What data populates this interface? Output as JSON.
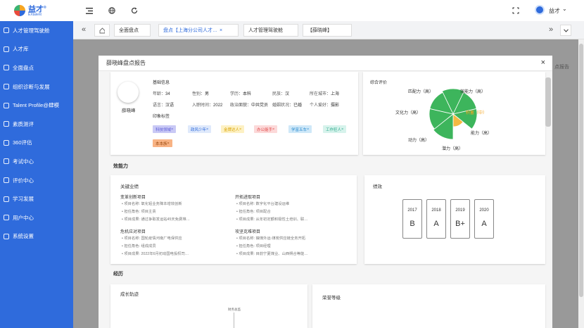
{
  "brand": {
    "name": "益才",
    "sub": "EXtalent",
    "mark": "®"
  },
  "sidebar": {
    "items": [
      {
        "label": "人才管理驾驶舱",
        "icon": "dashboard-icon"
      },
      {
        "label": "人才库",
        "icon": "user-icon"
      },
      {
        "label": "全面盘点",
        "icon": "inventory-icon"
      },
      {
        "label": "组织诊断与发展",
        "icon": "org-icon"
      },
      {
        "label": "Talent Profile@肆模",
        "icon": "profile-icon"
      },
      {
        "label": "素质测评",
        "icon": "test-icon"
      },
      {
        "label": "360评估",
        "icon": "eval-icon"
      },
      {
        "label": "考试中心",
        "icon": "exam-icon"
      },
      {
        "label": "评价中心",
        "icon": "review-icon"
      },
      {
        "label": "学习发展",
        "icon": "learn-icon"
      },
      {
        "label": "用户中心",
        "icon": "users-icon"
      },
      {
        "label": "系统设置",
        "icon": "settings-icon"
      }
    ]
  },
  "header": {
    "user": "益才",
    "caret": "⌄"
  },
  "tabs": [
    {
      "label": "全面盘点",
      "active": false
    },
    {
      "label": "盘点【上海分公司人才…",
      "active": true
    },
    {
      "label": "人才管理驾驶舱",
      "active": false
    },
    {
      "label": "【薛晓峰】",
      "active": false
    }
  ],
  "tab_close": "×",
  "bg_right_label": "点报告",
  "modal": {
    "title": "薛晓峰盘点报告",
    "close": "×",
    "profile": {
      "name": "薛晓峰",
      "basic_title": "基础信息",
      "fields": [
        {
          "k": "年龄：",
          "v": "34"
        },
        {
          "k": "性别：",
          "v": "男"
        },
        {
          "k": "学历：",
          "v": "本科"
        },
        {
          "k": "民族：",
          "v": "汉"
        },
        {
          "k": "所在城市：",
          "v": "上海"
        },
        {
          "k": "语言：",
          "v": "汉语"
        },
        {
          "k": "入职时间：",
          "v": "2022"
        },
        {
          "k": "政治面貌：",
          "v": "中共党员"
        },
        {
          "k": "婚姻状况：",
          "v": "已婚"
        },
        {
          "k": "个人爱好：",
          "v": "摄影"
        }
      ],
      "tags_title": "印象标签",
      "tags": [
        {
          "label": "科技领域",
          "bg": "#c9c9f5",
          "fg": "#5b5bd6"
        },
        {
          "label": "政风少年",
          "bg": "#dfe9fb",
          "fg": "#2f6bdc"
        },
        {
          "label": "金牌达人",
          "bg": "#fdf1c4",
          "fg": "#d9a200"
        },
        {
          "label": "办公能手",
          "bg": "#fcd9d9",
          "fg": "#e04848"
        },
        {
          "label": "学富五车",
          "bg": "#cfe8f8",
          "fg": "#2a8bd0"
        },
        {
          "label": "工作狂人",
          "bg": "#d7f3ec",
          "fg": "#2aa88a"
        },
        {
          "label": "本本族",
          "bg": "#f8b384",
          "fg": "#9a4a10"
        }
      ]
    },
    "evaluation": {
      "title": "综合评价",
      "labels": [
        {
          "text": "匹配力（高）"
        },
        {
          "text": "效能力（高）"
        },
        {
          "text": "文化力（高）"
        },
        {
          "text": "积蓄（中）"
        },
        {
          "text": "能力（高）"
        },
        {
          "text": "动力（高）"
        },
        {
          "text": "潜力（高）"
        }
      ],
      "colors": {
        "high": "#3db55c",
        "mid": "#f5b942"
      }
    },
    "effect_title": "效能力",
    "kpi": {
      "title": "关键业绩",
      "groups": [
        {
          "title": "变革创新项目",
          "lines": [
            "项目名称: 氧化铝业务降本增效创新",
            "担任角色: 项目主责",
            "项目成果: 通过争取发运站45天免费堆…"
          ]
        },
        {
          "title": "开拓进取项目",
          "lines": [
            "项目名称: 数字化平台建设运维",
            "担任角色: 项目配合",
            "项目成果: 从年初定额积极性土培训、联…"
          ]
        },
        {
          "title": "危机应对项目",
          "lines": [
            "项目名称: 国轮疫情河南厂电保供应",
            "担任角色: 组成成员",
            "项目成果: 2022年6月初动国电投权司…"
          ]
        },
        {
          "title": "攻坚克难项目",
          "lines": [
            "项目名称: 镍煤外运-煤炭供应链全务开拓",
            "担任角色: 项目经理",
            "项目成果: 目前宁夏煤业、山西朔合等能…"
          ]
        }
      ]
    },
    "performance": {
      "title": "绩效",
      "grades": [
        {
          "year": "2017",
          "grade": "B"
        },
        {
          "year": "2018",
          "grade": "A"
        },
        {
          "year": "2019",
          "grade": "B+"
        },
        {
          "year": "2020",
          "grade": "A"
        }
      ]
    },
    "experience_title": "经历",
    "growth": {
      "title": "成长轨迹",
      "hint": "财务总监"
    },
    "honor": {
      "title": "荣誉等级"
    }
  }
}
